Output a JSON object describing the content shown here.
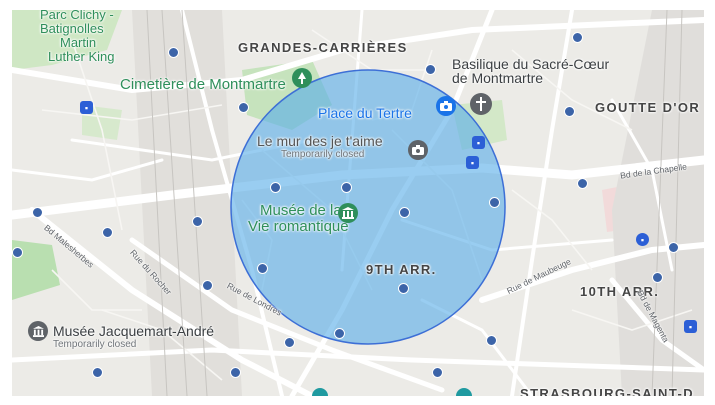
{
  "labels": {
    "parc_clichy": "Parc Clichy -",
    "batignolles": "Batignolles",
    "martin": "Martin",
    "luther_king": "Luther King",
    "grandes_carrieres": "GRANDES-CARRIÈRES",
    "cimetiere": "Cimetière de Montmartre",
    "basilique_1": "Basilique du Sacré-Cœur",
    "basilique_2": "de Montmartre",
    "goutte_dor": "GOUTTE D'OR",
    "place_du_tertre": "Place du Tertre",
    "mur_je_taime": "Le mur des je t'aime",
    "mur_status": "Temporarily closed",
    "musee_vie_1": "Musée de la",
    "musee_vie_2": "Vie romantique",
    "ninth_arr": "9TH ARR.",
    "tenth_arr": "10TH ARR.",
    "jacquemart": "Musée Jacquemart-André",
    "jacquemart_status": "Temporarily closed",
    "strasbourg": "STRASBOURG-SAINT-D",
    "bd_chapelle": "Bd de la Chapelle",
    "bd_malesherbes": "Bd Malesherbes",
    "rue_rocher": "Rue du Rocher",
    "rue_londres": "Rue de Londres",
    "rue_maubeuge": "Rue de Maubeuge",
    "rue_magenta": "Bd de Magenta"
  },
  "icons": [
    "cemetery-icon",
    "church-icon",
    "camera-icon",
    "museum-icon",
    "metro-icon",
    "bus-icon",
    "rail-icon"
  ],
  "colors": {
    "radius_fill": "#5aaee8",
    "radius_stroke": "#3d6fd6",
    "poi_green": "#2f8f5b",
    "poi_blue": "#1a73e8",
    "park": "#b9dfb0"
  }
}
